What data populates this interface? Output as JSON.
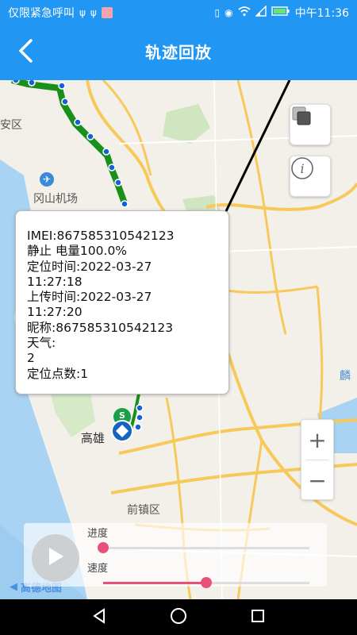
{
  "status_bar": {
    "left_text": "仅限紧急呼叫",
    "time": "中午11:36",
    "accent_color": "#2196f3",
    "left_icons": [
      "usb-icon",
      "usb-icon",
      "app-icon"
    ],
    "right_icons": [
      "vibrate-icon",
      "eye-icon",
      "wifi-icon",
      "signal-icon",
      "battery-icon"
    ]
  },
  "header": {
    "title": "轨迹回放",
    "back_icon": "chevron-left-icon"
  },
  "map": {
    "labels": {
      "district_top": "安区",
      "airport": "冈山机场",
      "city": "高雄",
      "district_bottom": "前镇区",
      "right_place": "麟"
    },
    "start_marker": "S",
    "route_color": "#1a8f1a",
    "point_color": "#1560d8",
    "attribution": "高德地图"
  },
  "info_window": {
    "imei": "IMEI:867585310542123",
    "status": "静止 电量100.0%",
    "locate_time_label": "定位时间:2022-03-27",
    "locate_time_clock": "11:27:18",
    "upload_time_label": "上传时间:2022-03-27",
    "upload_time_clock": "11:27:20",
    "nickname": "昵称:867585310542123",
    "weather_label": "天气:",
    "weather_value": "2",
    "points_count": "定位点数:1"
  },
  "controls": {
    "layers_icon": "layers-icon",
    "info_icon": "info-icon",
    "zoom_in": "+",
    "zoom_out": "−"
  },
  "playback": {
    "progress_label": "进度",
    "speed_label": "速度",
    "progress_value": 0,
    "speed_value": 0.5,
    "thumb_color": "#e8507a",
    "play_icon": "play-icon"
  },
  "nav": {
    "back_icon": "nav-back-icon",
    "home_icon": "nav-home-icon",
    "recents_icon": "nav-recents-icon"
  }
}
